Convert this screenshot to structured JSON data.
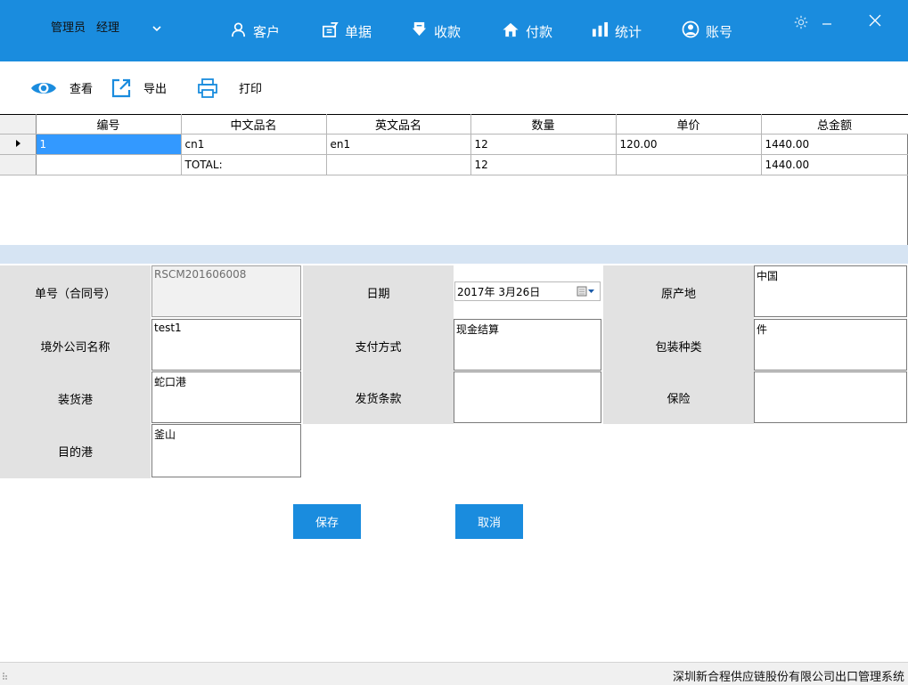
{
  "header": {
    "user_role": "管理员",
    "user_title": "经理",
    "nav": [
      {
        "label": "客户",
        "icon": "user-icon"
      },
      {
        "label": "单据",
        "icon": "document-icon"
      },
      {
        "label": "收款",
        "icon": "download-icon"
      },
      {
        "label": "付款",
        "icon": "home-icon"
      },
      {
        "label": "统计",
        "icon": "bar-chart-icon"
      },
      {
        "label": "账号",
        "icon": "account-icon"
      }
    ],
    "colors": {
      "bar": "#1a8cde",
      "text": "#ffffff"
    }
  },
  "toolbar": {
    "view_label": "查看",
    "export_label": "导出",
    "print_label": "打印"
  },
  "grid": {
    "columns": [
      "编号",
      "中文品名",
      "英文品名",
      "数量",
      "单价",
      "总金额"
    ],
    "rows": [
      [
        "1",
        "cn1",
        "en1",
        "12",
        "120.00",
        "1440.00"
      ],
      [
        "",
        "TOTAL:",
        "",
        "12",
        "",
        "1440.00"
      ]
    ],
    "selected_color": "#3399ff"
  },
  "form": {
    "contract_no_label": "单号（合同号）",
    "contract_no_value": "RSCM201606008",
    "date_label": "日期",
    "date_value": "2017年  3月26日",
    "origin_label": "原产地",
    "origin_value": "中国",
    "overseas_company_label": "境外公司名称",
    "overseas_company_value": "test1",
    "payment_method_label": "支付方式",
    "payment_method_value": "现金结算",
    "package_type_label": "包装种类",
    "package_type_value": "件",
    "loading_port_label": "装货港",
    "loading_port_value": "蛇口港",
    "shipping_terms_label": "发货条款",
    "shipping_terms_value": "",
    "insurance_label": "保险",
    "insurance_value": "",
    "destination_port_label": "目的港",
    "destination_port_value": "釜山"
  },
  "actions": {
    "save_label": "保存",
    "cancel_label": "取消"
  },
  "status": {
    "text": "深圳新合程供应链股份有限公司出口管理系统"
  }
}
